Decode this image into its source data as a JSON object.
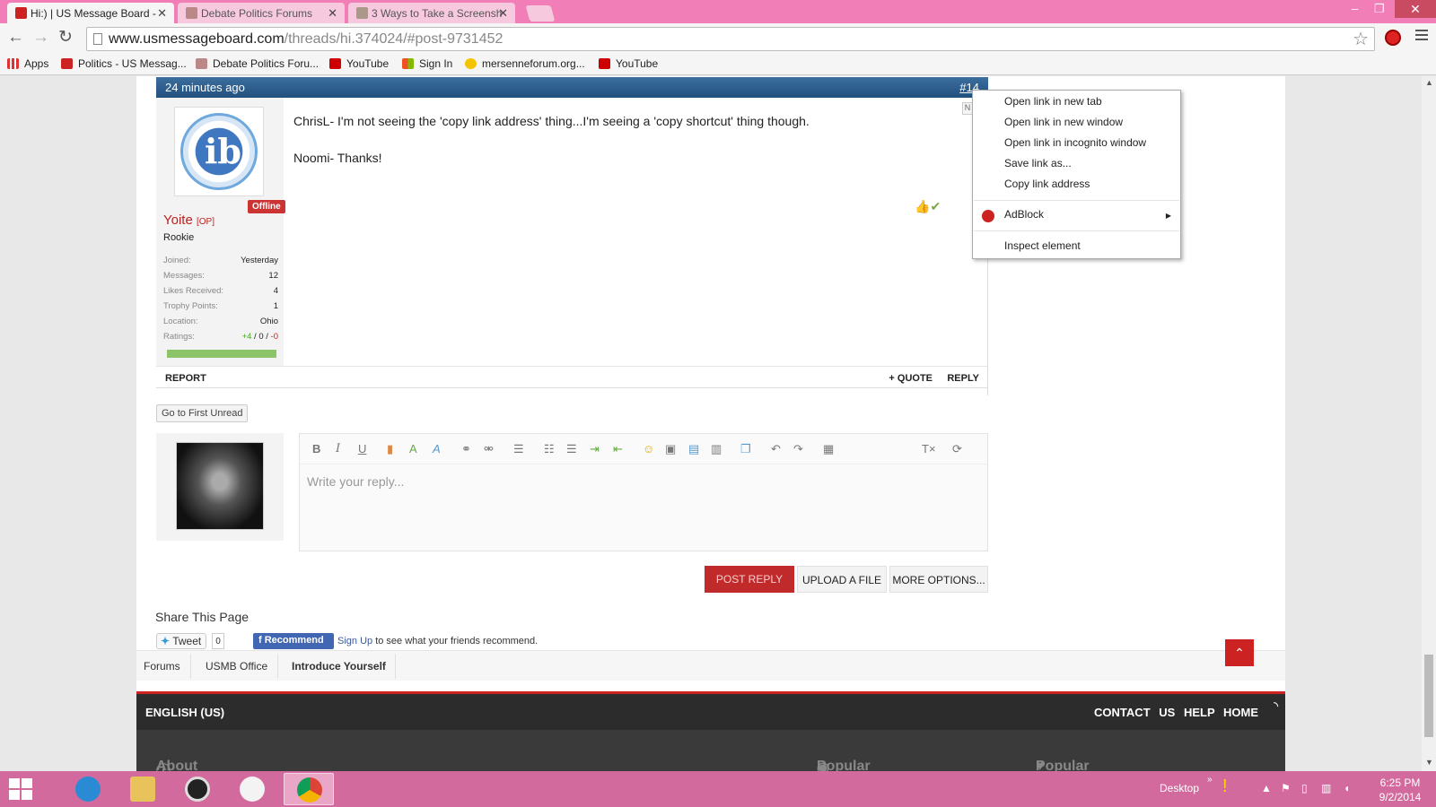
{
  "browser": {
    "tabs": [
      {
        "title": "Hi:) | US Message Board -",
        "active": true
      },
      {
        "title": "Debate Politics Forums",
        "active": false
      },
      {
        "title": "3 Ways to Take a Screensh",
        "active": false
      }
    ],
    "url_host": "www.usmessageboard.com",
    "url_path": "/threads/hi.374024/#post-9731452",
    "bookmarks": [
      "Apps",
      "Politics - US Messag...",
      "Debate Politics Foru...",
      "YouTube",
      "Sign In",
      "mersenneforum.org...",
      "YouTube"
    ]
  },
  "post": {
    "time": "24 minutes ago",
    "number": "#14",
    "message_lines": [
      "ChrisL- I'm not seeing the 'copy link address' thing...I'm seeing a 'copy shortcut' thing though.",
      "Noomi- Thanks!"
    ],
    "report_label": "REPORT",
    "quote_label": "+ QUOTE",
    "reply_label": "REPLY"
  },
  "user": {
    "avatar_text": "ib",
    "status": "Offline",
    "name": "Yoite",
    "op_tag": "[OP]",
    "rank": "Rookie",
    "stats": [
      {
        "label": "Joined:",
        "value": "Yesterday"
      },
      {
        "label": "Messages:",
        "value": "12"
      },
      {
        "label": "Likes Received:",
        "value": "4"
      },
      {
        "label": "Trophy Points:",
        "value": "1"
      },
      {
        "label": "Location:",
        "value": "Ohio"
      }
    ],
    "ratings_label": "Ratings:",
    "ratings_pos": "+4",
    "ratings_neutral": "0",
    "ratings_neg": "-0"
  },
  "thread": {
    "first_unread": "Go to First Unread"
  },
  "editor": {
    "placeholder": "Write your reply...",
    "post_reply": "POST REPLY",
    "upload": "UPLOAD A FILE",
    "more_options": "MORE OPTIONS..."
  },
  "share": {
    "title": "Share This Page",
    "tweet": "Tweet",
    "tweet_count": "0",
    "recommend": "Recommend",
    "signup": "Sign Up",
    "signup_rest": "to see what your friends recommend."
  },
  "breadcrumbs": [
    "Forums",
    "USMB Office",
    "Introduce Yourself"
  ],
  "footer": {
    "language": "ENGLISH (US)",
    "links": [
      "CONTACT US",
      "HELP",
      "HOME"
    ],
    "sections": [
      "About USMessageBoard.com",
      "Popular Links",
      "Popular Sections"
    ]
  },
  "context_menu": {
    "items": [
      "Open link in new tab",
      "Open link in new window",
      "Open link in incognito window",
      "Save link as...",
      "Copy link address",
      "AdBlock",
      "Inspect element"
    ]
  },
  "taskbar": {
    "desktop_label": "Desktop",
    "time": "6:25 PM",
    "date": "9/2/2014"
  }
}
